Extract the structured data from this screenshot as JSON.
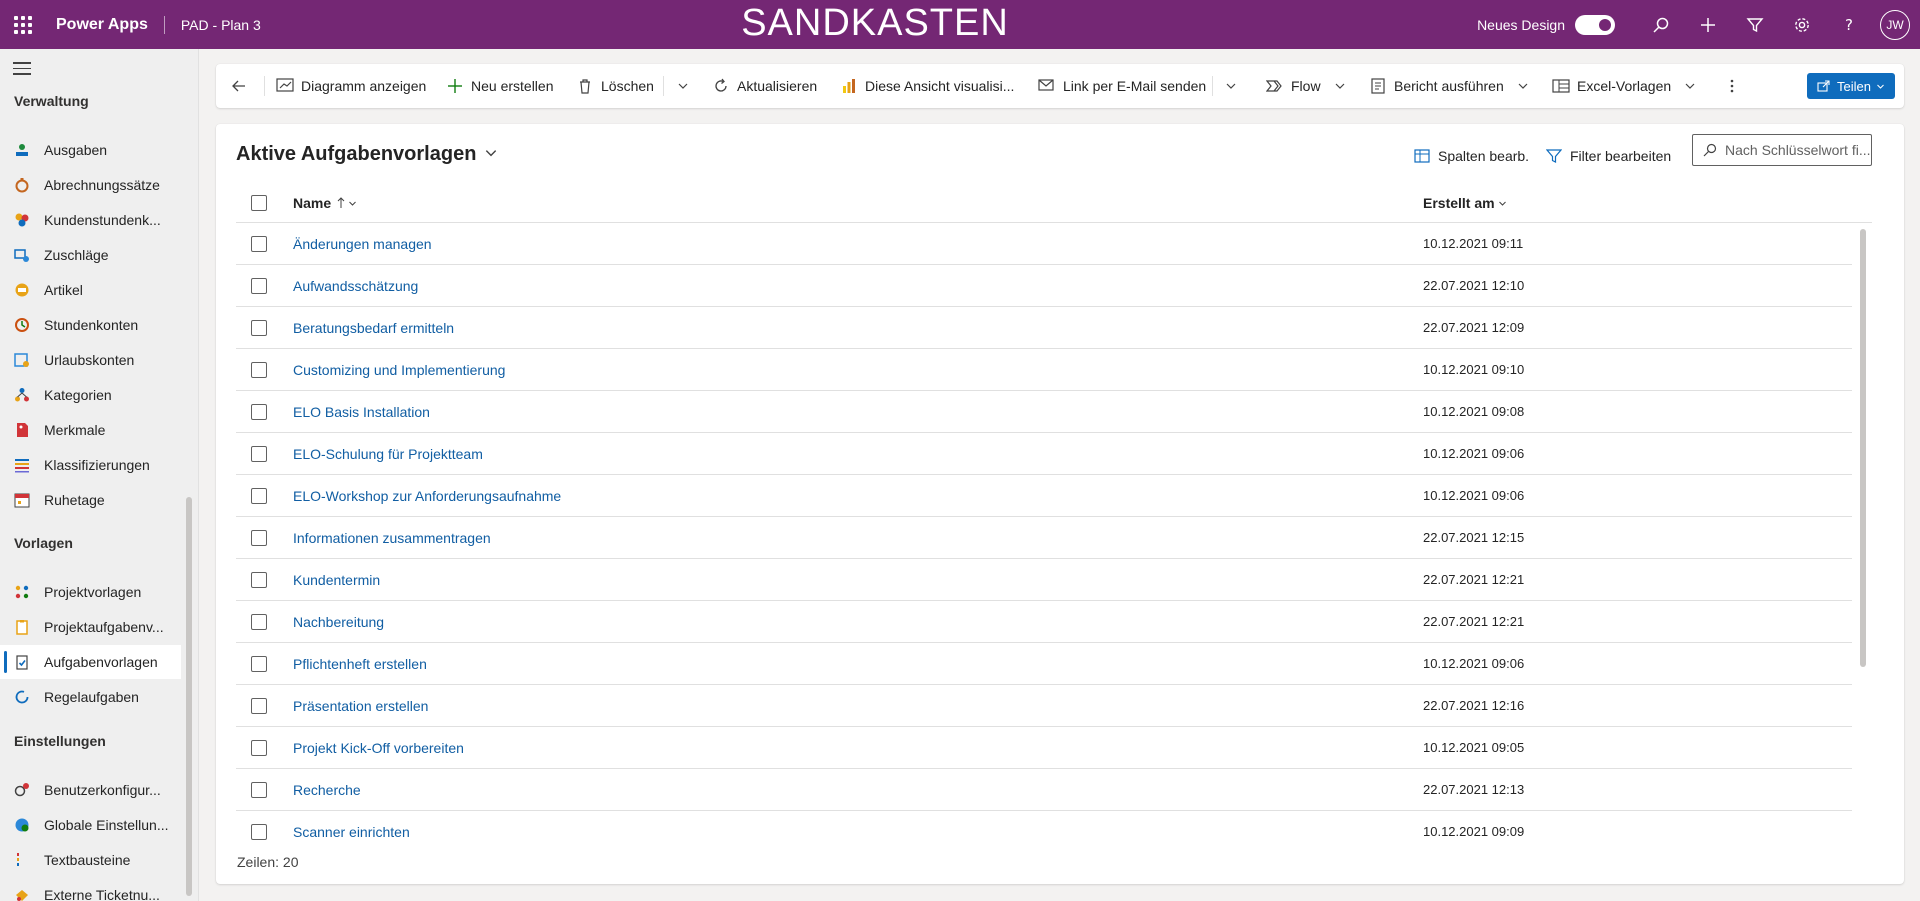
{
  "topbar": {
    "app_name": "Power Apps",
    "environment": "PAD - Plan 3",
    "banner": "SANDKASTEN",
    "new_design_label": "Neues Design",
    "new_design_enabled": true,
    "avatar_initials": "JW",
    "icons": [
      "waffle-icon",
      "search-icon",
      "plus-icon",
      "filter-icon",
      "settings-gear-icon",
      "help-question-icon"
    ]
  },
  "sidebar": {
    "groups": [
      {
        "title": "Verwaltung",
        "items": [
          {
            "label": "Ausgaben",
            "icon": "expenses-icon",
            "color": "#1e8a3c"
          },
          {
            "label": "Abrechnungssätze",
            "icon": "stopwatch-icon",
            "color": "#c4661f"
          },
          {
            "label": "Kundenstundenk...",
            "icon": "customer-hours-icon",
            "color": "#d13438"
          },
          {
            "label": "Zuschläge",
            "icon": "surcharge-icon",
            "color": "#0f6cbd"
          },
          {
            "label": "Artikel",
            "icon": "article-icon",
            "color": "#e8a317"
          },
          {
            "label": "Stundenkonten",
            "icon": "hours-account-icon",
            "color": "#ca5010"
          },
          {
            "label": "Urlaubskonten",
            "icon": "vacation-account-icon",
            "color": "#2b88d8"
          },
          {
            "label": "Kategorien",
            "icon": "categories-icon",
            "color": "#0f6cbd"
          },
          {
            "label": "Merkmale",
            "icon": "feature-tag-icon",
            "color": "#d13438"
          },
          {
            "label": "Klassifizierungen",
            "icon": "classification-icon",
            "color": "#6b69d6"
          },
          {
            "label": "Ruhetage",
            "icon": "calendar-icon",
            "color": "#d13438"
          }
        ]
      },
      {
        "title": "Vorlagen",
        "items": [
          {
            "label": "Projektvorlagen",
            "icon": "project-template-icon",
            "color": "#e8a317"
          },
          {
            "label": "Projektaufgabenv...",
            "icon": "project-task-template-icon",
            "color": "#e8a317"
          },
          {
            "label": "Aufgabenvorlagen",
            "icon": "task-template-icon",
            "color": "#0f6cbd",
            "selected": true
          },
          {
            "label": "Regelaufgaben",
            "icon": "recurring-task-icon",
            "color": "#0f6cbd"
          }
        ]
      },
      {
        "title": "Einstellungen",
        "items": [
          {
            "label": "Benutzerkonfigur...",
            "icon": "user-config-icon",
            "color": "#d13438"
          },
          {
            "label": "Globale Einstellun...",
            "icon": "globe-settings-icon",
            "color": "#0f6cbd"
          },
          {
            "label": "Textbausteine",
            "icon": "text-blocks-icon",
            "color": "#d13438"
          },
          {
            "label": "Externe Ticketnu...",
            "icon": "external-ticket-icon",
            "color": "#e8a317"
          }
        ]
      }
    ]
  },
  "commandbar": {
    "back_icon": "back-arrow-icon",
    "show_chart": "Diagramm anzeigen",
    "new": "Neu erstellen",
    "delete": "Löschen",
    "refresh": "Aktualisieren",
    "visualize": "Diese Ansicht visualisi...",
    "email_link": "Link per E-Mail senden",
    "flow": "Flow",
    "run_report": "Bericht ausführen",
    "excel_templates": "Excel-Vorlagen",
    "share": "Teilen"
  },
  "view": {
    "title": "Aktive Aufgabenvorlagen",
    "edit_columns": "Spalten bearb.",
    "edit_filters": "Filter bearbeiten",
    "search_placeholder": "Nach Schlüsselwort fi...",
    "columns": {
      "name": "Name",
      "created": "Erstellt am"
    },
    "rows": [
      {
        "name": "Änderungen managen",
        "created": "10.12.2021 09:11"
      },
      {
        "name": "Aufwandsschätzung",
        "created": "22.07.2021 12:10"
      },
      {
        "name": "Beratungsbedarf ermitteln",
        "created": "22.07.2021 12:09"
      },
      {
        "name": "Customizing und Implementierung",
        "created": "10.12.2021 09:10"
      },
      {
        "name": "ELO Basis Installation",
        "created": "10.12.2021 09:08"
      },
      {
        "name": "ELO-Schulung für Projektteam",
        "created": "10.12.2021 09:06"
      },
      {
        "name": "ELO-Workshop zur Anforderungsaufnahme",
        "created": "10.12.2021 09:06"
      },
      {
        "name": "Informationen zusammentragen",
        "created": "22.07.2021 12:15"
      },
      {
        "name": "Kundentermin",
        "created": "22.07.2021 12:21"
      },
      {
        "name": "Nachbereitung",
        "created": "22.07.2021 12:21"
      },
      {
        "name": "Pflichtenheft erstellen",
        "created": "10.12.2021 09:06"
      },
      {
        "name": "Präsentation erstellen",
        "created": "22.07.2021 12:16"
      },
      {
        "name": "Projekt Kick-Off vorbereiten",
        "created": "10.12.2021 09:05"
      },
      {
        "name": "Recherche",
        "created": "22.07.2021 12:13"
      },
      {
        "name": "Scanner einrichten",
        "created": "10.12.2021 09:09"
      }
    ],
    "row_count_label": "Zeilen: 20"
  }
}
